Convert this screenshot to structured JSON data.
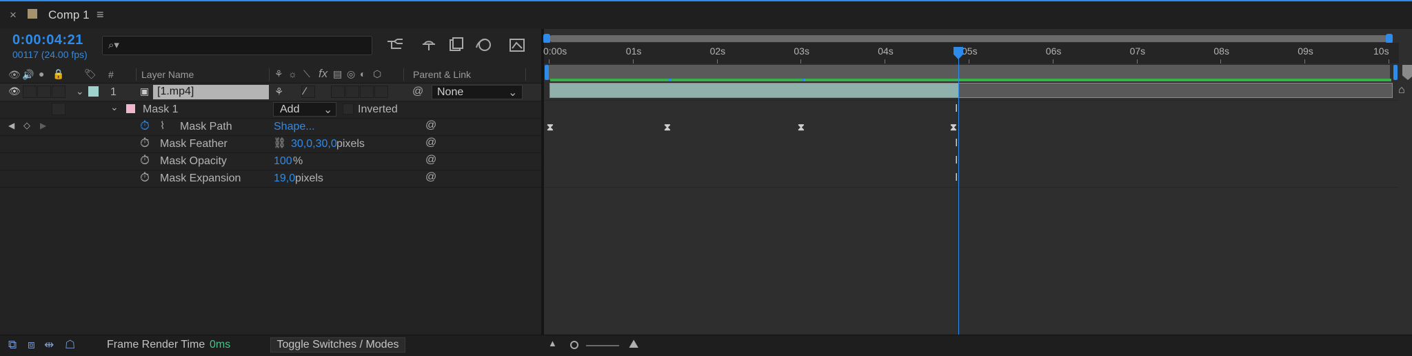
{
  "tab": {
    "close": "×",
    "name": "Comp 1",
    "menu": "≡"
  },
  "time": {
    "timecode": "0:00:04:21",
    "frames": "00117 (24.00 fps)"
  },
  "search": {
    "glyph": "⌕▾",
    "placeholder": ""
  },
  "columns": {
    "hash": "#",
    "layer_name": "Layer Name",
    "fx": "fx",
    "parent_link": "Parent & Link"
  },
  "layer": {
    "number": "1",
    "name": "[1.mp4]",
    "parent": "None",
    "color": "#9fd2cc"
  },
  "mask": {
    "name": "Mask 1",
    "mode": "Add",
    "inverted": "Inverted",
    "color": "#f0b6cd"
  },
  "properties": [
    {
      "label": "Mask Path",
      "value": "Shape...",
      "unit": ""
    },
    {
      "label": "Mask Feather",
      "value": "30,0,30,0",
      "unit": " pixels"
    },
    {
      "label": "Mask Opacity",
      "value": "100",
      "unit": "%"
    },
    {
      "label": "Mask Expansion",
      "value": "19,0",
      "unit": " pixels"
    }
  ],
  "ruler": {
    "labels": [
      "0:00s",
      "01s",
      "02s",
      "03s",
      "04s",
      "05s",
      "06s",
      "07s",
      "08s",
      "09s",
      "10s"
    ],
    "current_time_seconds": 4.875
  },
  "bottom": {
    "frame_render_label": "Frame Render Time",
    "frame_render_value": "0ms",
    "toggle": "Toggle Switches / Modes"
  },
  "colors": {
    "accent": "#2d8ceb",
    "layer_bar": "#8fb1ab",
    "work_area": "#37b24a"
  }
}
